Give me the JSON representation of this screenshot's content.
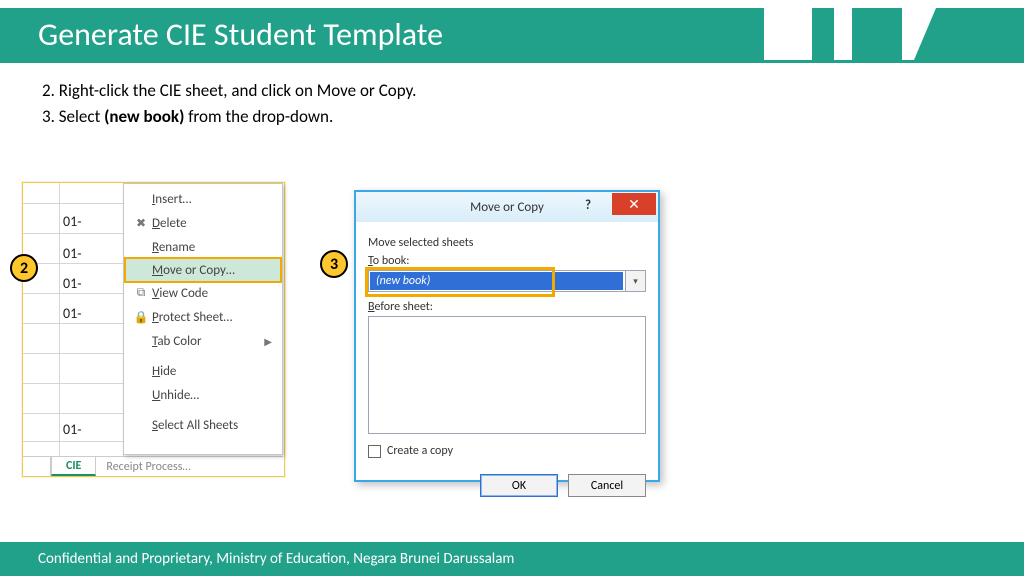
{
  "title": "Generate CIE Student Template",
  "instructions": {
    "step2_prefix": "2. Right-click the CIE sheet, and click on Move or Copy.",
    "step3_prefix": "3. Select ",
    "step3_bold": "(new book)",
    "step3_suffix": " from the drop-down."
  },
  "markers": {
    "step2": "2",
    "step3": "3"
  },
  "sheet": {
    "cells": [
      "01-",
      "01-",
      "01-",
      "01-",
      "01-"
    ],
    "tab_active": "CIE",
    "tab_dim": "Receipt    Process…"
  },
  "context_menu": {
    "insert": "Insert…",
    "delete": "Delete",
    "rename": "Rename",
    "move_or_copy": "Move or Copy…",
    "view_code": "View Code",
    "protect_sheet": "Protect Sheet…",
    "tab_color": "Tab Color",
    "hide": "Hide",
    "unhide": "Unhide…",
    "select_all": "Select All Sheets"
  },
  "dialog": {
    "title": "Move or Copy",
    "help": "?",
    "close": "✕",
    "move_selected": "Move selected sheets",
    "to_book": "To book:",
    "selected_value": "(new book)",
    "before_sheet": "Before sheet:",
    "create_copy": "Create a copy",
    "ok": "OK",
    "cancel": "Cancel"
  },
  "footer": "Confidential and Proprietary, Ministry of Education, Negara Brunei Darussalam"
}
